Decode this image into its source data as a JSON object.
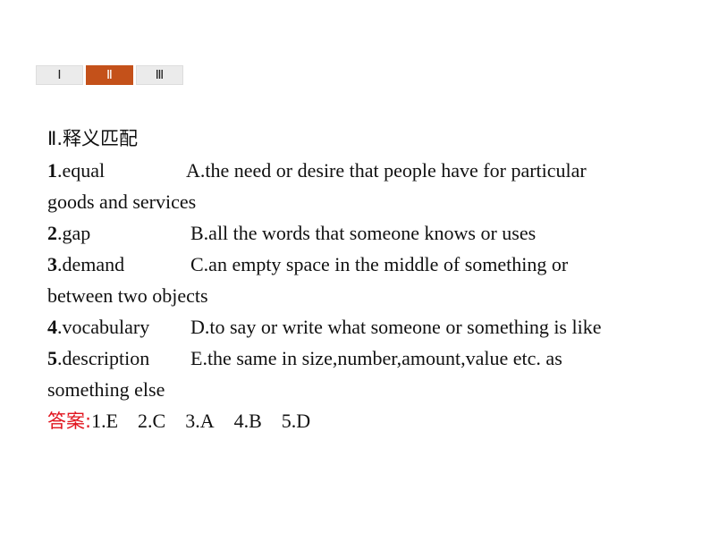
{
  "tabs": [
    {
      "label": "Ⅰ",
      "active": false
    },
    {
      "label": "Ⅱ",
      "active": true
    },
    {
      "label": "Ⅲ",
      "active": false
    }
  ],
  "colors": {
    "active_tab": "#c4511a",
    "answer_label": "#e1141e"
  },
  "section": {
    "heading": "Ⅱ.释义匹配",
    "items": [
      {
        "num": "1",
        "word": ".equal",
        "def": "A.the need or desire that people have for particular",
        "cont": "goods and services"
      },
      {
        "num": "2",
        "word": ".gap",
        "def": "B.all the words that someone knows or uses"
      },
      {
        "num": "3",
        "word": ".demand",
        "def": "C.an empty space in the middle of something or",
        "cont": "between two objects"
      },
      {
        "num": "4",
        "word": ".vocabulary",
        "def": "D.to say or write what someone or something is like"
      },
      {
        "num": "5",
        "word": ".description",
        "def": "E.the same in size,number,amount,value etc. as",
        "cont": "something else"
      }
    ],
    "answer_label": "答案:",
    "answers": [
      "1.E",
      "2.C",
      "3.A",
      "4.B",
      "5.D"
    ]
  }
}
